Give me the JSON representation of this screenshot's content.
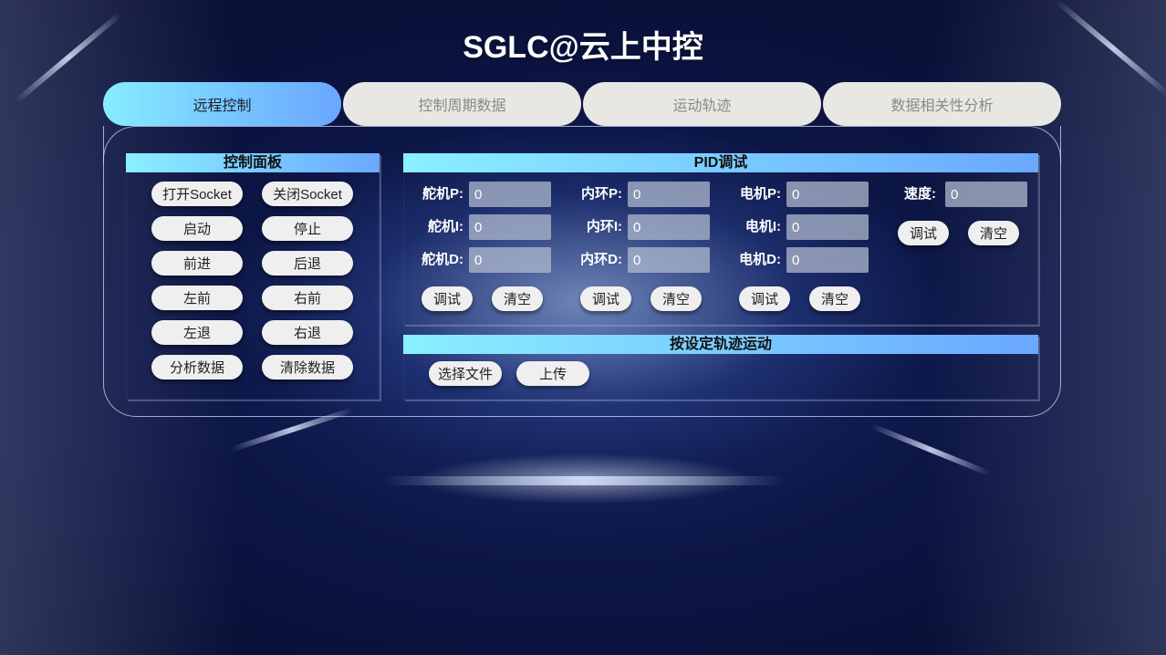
{
  "app_title": "SGLC@云上中控",
  "tabs": [
    {
      "label": "远程控制",
      "active": true
    },
    {
      "label": "控制周期数据",
      "active": false
    },
    {
      "label": "运动轨迹",
      "active": false
    },
    {
      "label": "数据相关性分析",
      "active": false
    }
  ],
  "control_panel": {
    "title": "控制面板",
    "buttons": [
      "打开Socket",
      "关闭Socket",
      "启动",
      "停止",
      "前进",
      "后退",
      "左前",
      "右前",
      "左退",
      "右退",
      "分析数据",
      "清除数据"
    ]
  },
  "pid": {
    "title": "PID调试",
    "groups": [
      {
        "labels": [
          "舵机P:",
          "舵机I:",
          "舵机D:"
        ],
        "values": [
          "0",
          "0",
          "0"
        ],
        "debug_label": "调试",
        "clear_label": "清空"
      },
      {
        "labels": [
          "内环P:",
          "内环I:",
          "内环D:"
        ],
        "values": [
          "0",
          "0",
          "0"
        ],
        "debug_label": "调试",
        "clear_label": "清空"
      },
      {
        "labels": [
          "电机P:",
          "电机I:",
          "电机D:"
        ],
        "values": [
          "0",
          "0",
          "0"
        ],
        "debug_label": "调试",
        "clear_label": "清空"
      }
    ],
    "speed": {
      "label": "速度:",
      "value": "0",
      "debug_label": "调试",
      "clear_label": "清空"
    }
  },
  "trajectory": {
    "title": "按设定轨迹运动",
    "select_label": "选择文件",
    "upload_label": "上传"
  },
  "colors": {
    "tab_active_start": "#86ecff",
    "tab_active_end": "#6aa6ff",
    "tab_inactive": "#e8e7e3",
    "background": "#0d1748"
  }
}
